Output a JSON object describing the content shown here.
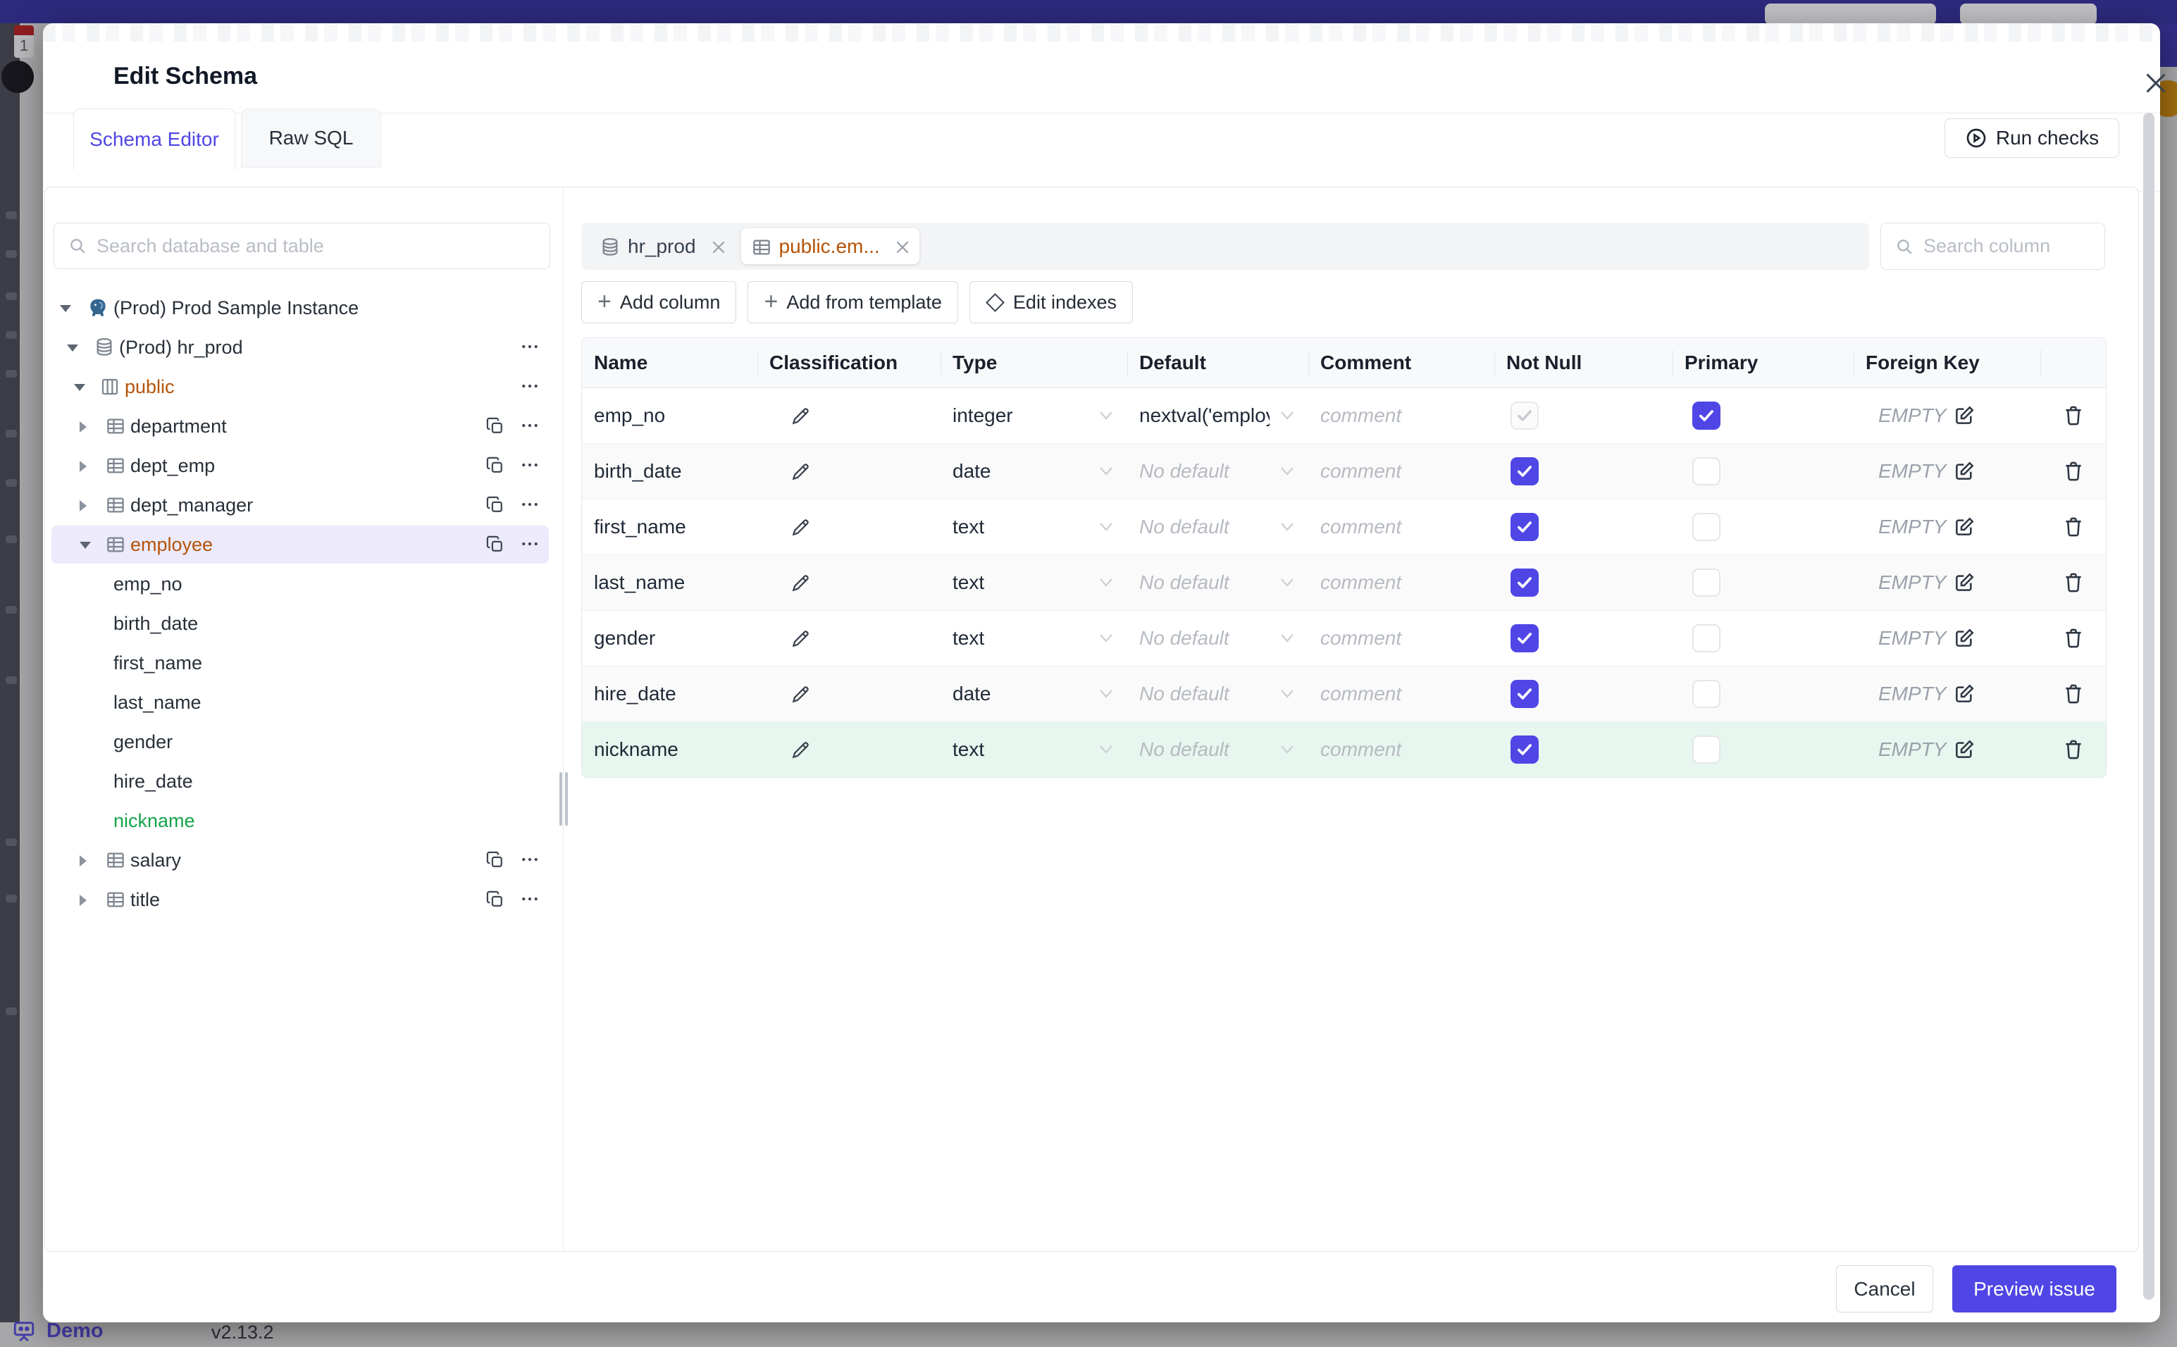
{
  "backdrop": {
    "demo_label": "Demo",
    "version": "v2.13.2"
  },
  "modal": {
    "title": "Edit Schema"
  },
  "tabs": [
    {
      "label": "Schema Editor",
      "active": true
    },
    {
      "label": "Raw SQL",
      "active": false
    }
  ],
  "run_checks_label": "Run checks",
  "sidebar": {
    "search_placeholder": "Search database and table",
    "tree": [
      {
        "level": 0,
        "type": "instance",
        "label": "(Prod) Prod Sample Instance",
        "expanded": true
      },
      {
        "level": 1,
        "type": "database",
        "label": "(Prod) hr_prod",
        "expanded": true,
        "more": true
      },
      {
        "level": 2,
        "type": "schema",
        "label": "public",
        "expanded": true,
        "more": true,
        "accent": "amber"
      },
      {
        "level": 3,
        "type": "table",
        "label": "department",
        "copy": true,
        "more": true
      },
      {
        "level": 3,
        "type": "table",
        "label": "dept_emp",
        "copy": true,
        "more": true
      },
      {
        "level": 3,
        "type": "table",
        "label": "dept_manager",
        "copy": true,
        "more": true
      },
      {
        "level": 3,
        "type": "table",
        "label": "employee",
        "expanded": true,
        "copy": true,
        "more": true,
        "accent": "amber",
        "selected": true
      },
      {
        "level": 4,
        "type": "column",
        "label": "emp_no"
      },
      {
        "level": 4,
        "type": "column",
        "label": "birth_date"
      },
      {
        "level": 4,
        "type": "column",
        "label": "first_name"
      },
      {
        "level": 4,
        "type": "column",
        "label": "last_name"
      },
      {
        "level": 4,
        "type": "column",
        "label": "gender"
      },
      {
        "level": 4,
        "type": "column",
        "label": "hire_date"
      },
      {
        "level": 4,
        "type": "column",
        "label": "nickname",
        "accent": "green"
      },
      {
        "level": 3,
        "type": "table",
        "label": "salary",
        "copy": true,
        "more": true
      },
      {
        "level": 3,
        "type": "table",
        "label": "title",
        "copy": true,
        "more": true
      }
    ]
  },
  "editor": {
    "chips": [
      {
        "label": "hr_prod",
        "icon": "database",
        "active": false
      },
      {
        "label": "public.em...",
        "icon": "table",
        "active": true
      }
    ],
    "column_search_placeholder": "Search column",
    "toolbar": [
      {
        "label": "Add column",
        "icon": "plus"
      },
      {
        "label": "Add from template",
        "icon": "plus"
      },
      {
        "label": "Edit indexes",
        "icon": "diamond"
      }
    ],
    "table": {
      "headers": [
        "Name",
        "Classification",
        "Type",
        "Default",
        "Comment",
        "Not Null",
        "Primary",
        "Foreign Key"
      ],
      "comment_placeholder": "comment",
      "empty_fk_label": "EMPTY",
      "rows": [
        {
          "name": "emp_no",
          "type": "integer",
          "default": "nextval('employ",
          "default_placeholder": false,
          "not_null": true,
          "not_null_disabled": true,
          "primary": true,
          "state": "normal"
        },
        {
          "name": "birth_date",
          "type": "date",
          "default": "No default",
          "default_placeholder": true,
          "not_null": true,
          "not_null_disabled": false,
          "primary": false,
          "state": "normal"
        },
        {
          "name": "first_name",
          "type": "text",
          "default": "No default",
          "default_placeholder": true,
          "not_null": true,
          "not_null_disabled": false,
          "primary": false,
          "state": "normal"
        },
        {
          "name": "last_name",
          "type": "text",
          "default": "No default",
          "default_placeholder": true,
          "not_null": true,
          "not_null_disabled": false,
          "primary": false,
          "state": "normal"
        },
        {
          "name": "gender",
          "type": "text",
          "default": "No default",
          "default_placeholder": true,
          "not_null": true,
          "not_null_disabled": false,
          "primary": false,
          "state": "normal"
        },
        {
          "name": "hire_date",
          "type": "date",
          "default": "No default",
          "default_placeholder": true,
          "not_null": true,
          "not_null_disabled": false,
          "primary": false,
          "state": "normal"
        },
        {
          "name": "nickname",
          "type": "text",
          "default": "No default",
          "default_placeholder": true,
          "not_null": true,
          "not_null_disabled": false,
          "primary": false,
          "state": "added"
        }
      ]
    }
  },
  "footer": {
    "cancel_label": "Cancel",
    "submit_label": "Preview issue"
  },
  "colors": {
    "accent": "#4f46e5",
    "amber_accent": "#b45309",
    "green_accent": "#16a34a",
    "added_row_bg": "#e7f6ee",
    "selected_tree_bg": "#eceafb",
    "topbar": "#2d2a7e"
  }
}
